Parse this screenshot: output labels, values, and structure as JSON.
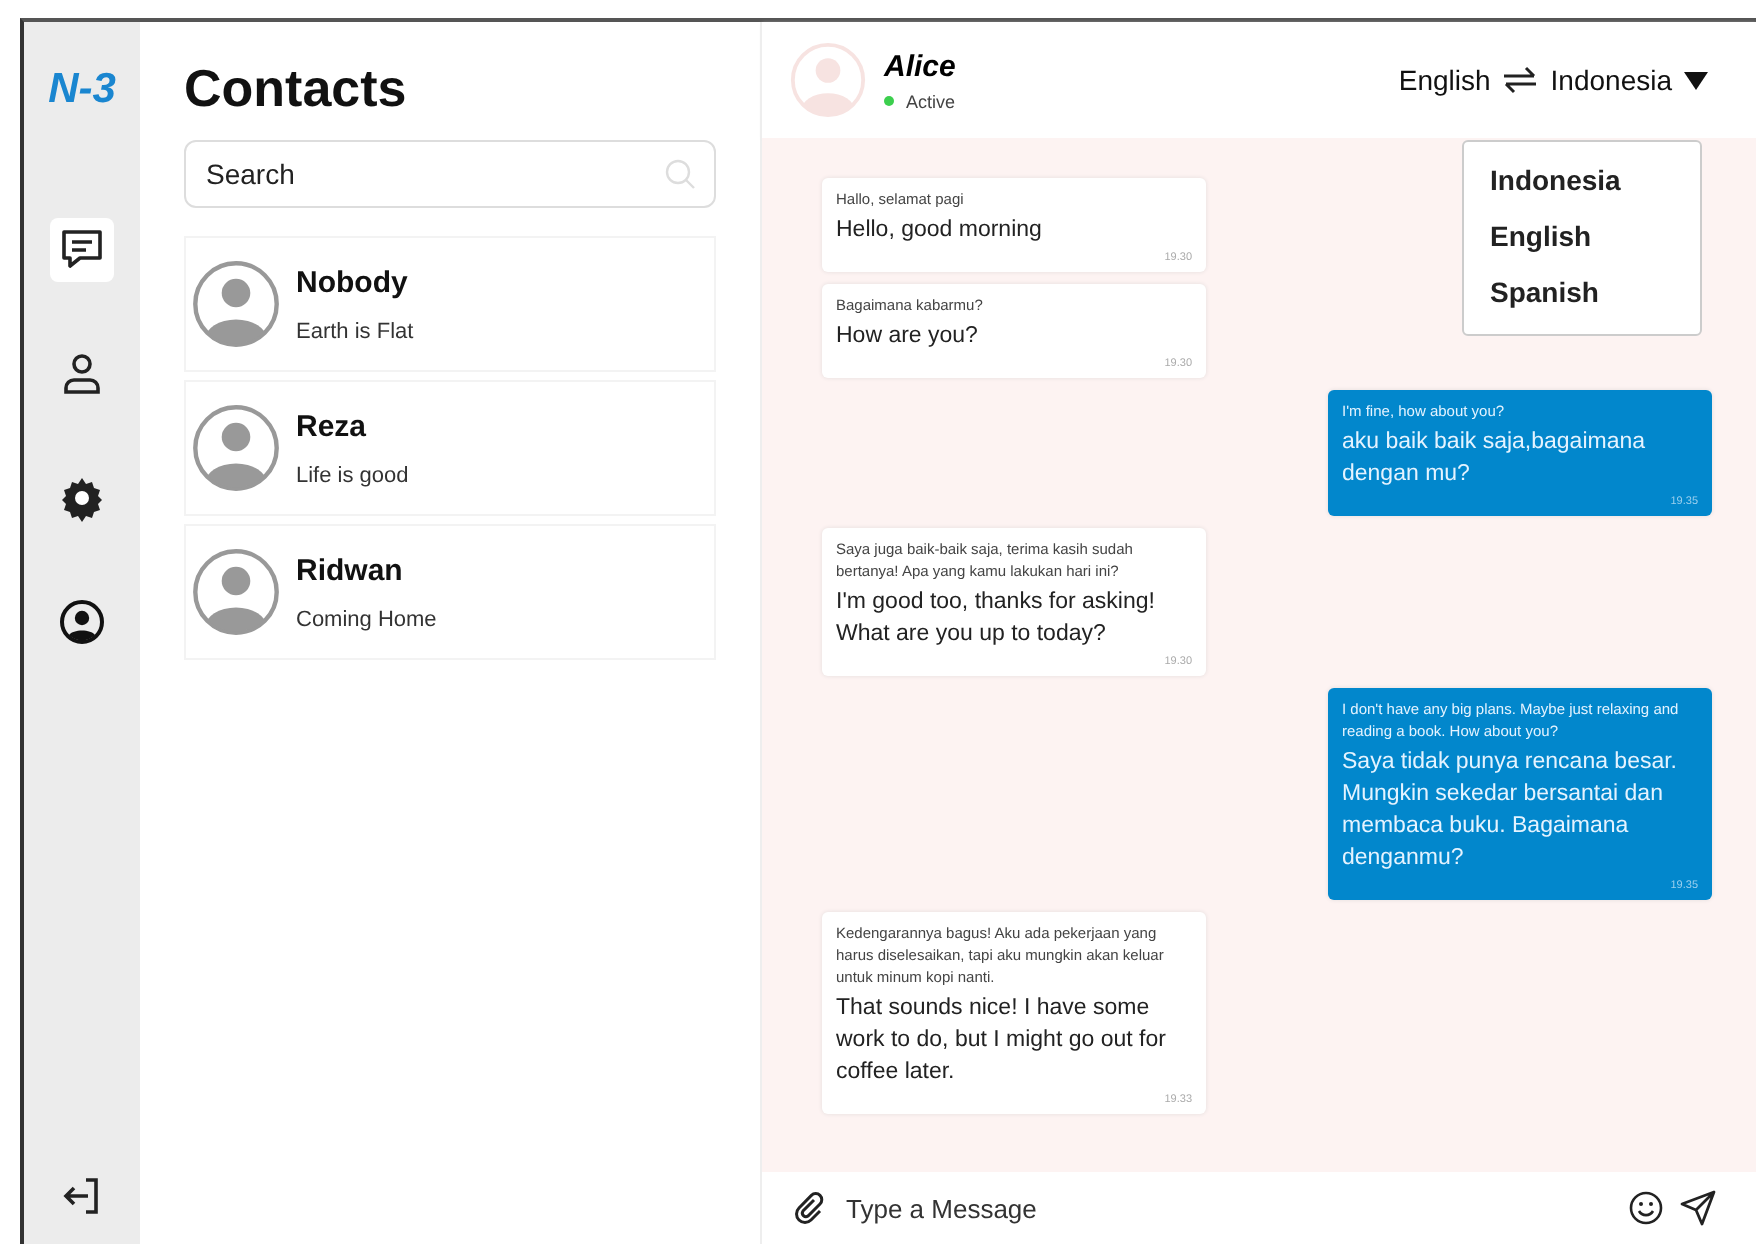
{
  "sidebar": {
    "logo": "N-3",
    "items": [
      {
        "kind": "chat",
        "selected": true
      },
      {
        "kind": "profile",
        "selected": false
      },
      {
        "kind": "settings",
        "selected": false
      },
      {
        "kind": "account",
        "selected": false
      }
    ]
  },
  "contacts": {
    "title": "Contacts",
    "search": {
      "placeholder": "Search"
    },
    "items": [
      {
        "name": "Nobody",
        "status": "Earth is Flat"
      },
      {
        "name": "Reza",
        "status": "Life is good"
      },
      {
        "name": "Ridwan",
        "status": "Coming Home"
      }
    ]
  },
  "chat": {
    "contact": {
      "name": "Alice",
      "status": "Active",
      "online": true
    },
    "language": {
      "source": "English",
      "target": "Indonesia"
    },
    "language_menu": [
      {
        "label": "Indonesia"
      },
      {
        "label": "English"
      },
      {
        "label": "Spanish"
      }
    ],
    "messages": [
      {
        "kind": "incoming",
        "original": "Hallo, selamat pagi",
        "translation": "Hello, good morning",
        "time": "19.30"
      },
      {
        "kind": "incoming",
        "original": "Bagaimana kabarmu?",
        "translation": "How are you?",
        "time": "19.30"
      },
      {
        "kind": "outgoing",
        "original": "I'm fine, how about you?",
        "translation": "aku baik baik saja,bagaimana dengan mu?",
        "time": "19.35"
      },
      {
        "kind": "incoming",
        "original": "Saya juga baik-baik saja, terima kasih sudah bertanya! Apa yang kamu lakukan hari ini?",
        "translation": "I'm good too, thanks for asking! What are you up to today?",
        "time": "19.30"
      },
      {
        "kind": "outgoing",
        "original": "I don't have any big plans. Maybe just relaxing and reading a book. How about you?",
        "translation": "Saya tidak punya rencana besar. Mungkin sekedar bersantai dan membaca buku. Bagaimana denganmu?",
        "time": "19.35"
      },
      {
        "kind": "incoming",
        "original": "Kedengarannya bagus! Aku ada pekerjaan yang harus diselesaikan, tapi aku mungkin akan keluar untuk minum kopi nanti.",
        "translation": "That sounds nice! I have some work to do, but I might go out for coffee later.",
        "time": "19.33"
      }
    ],
    "composer": {
      "placeholder": "Type a Message"
    }
  }
}
